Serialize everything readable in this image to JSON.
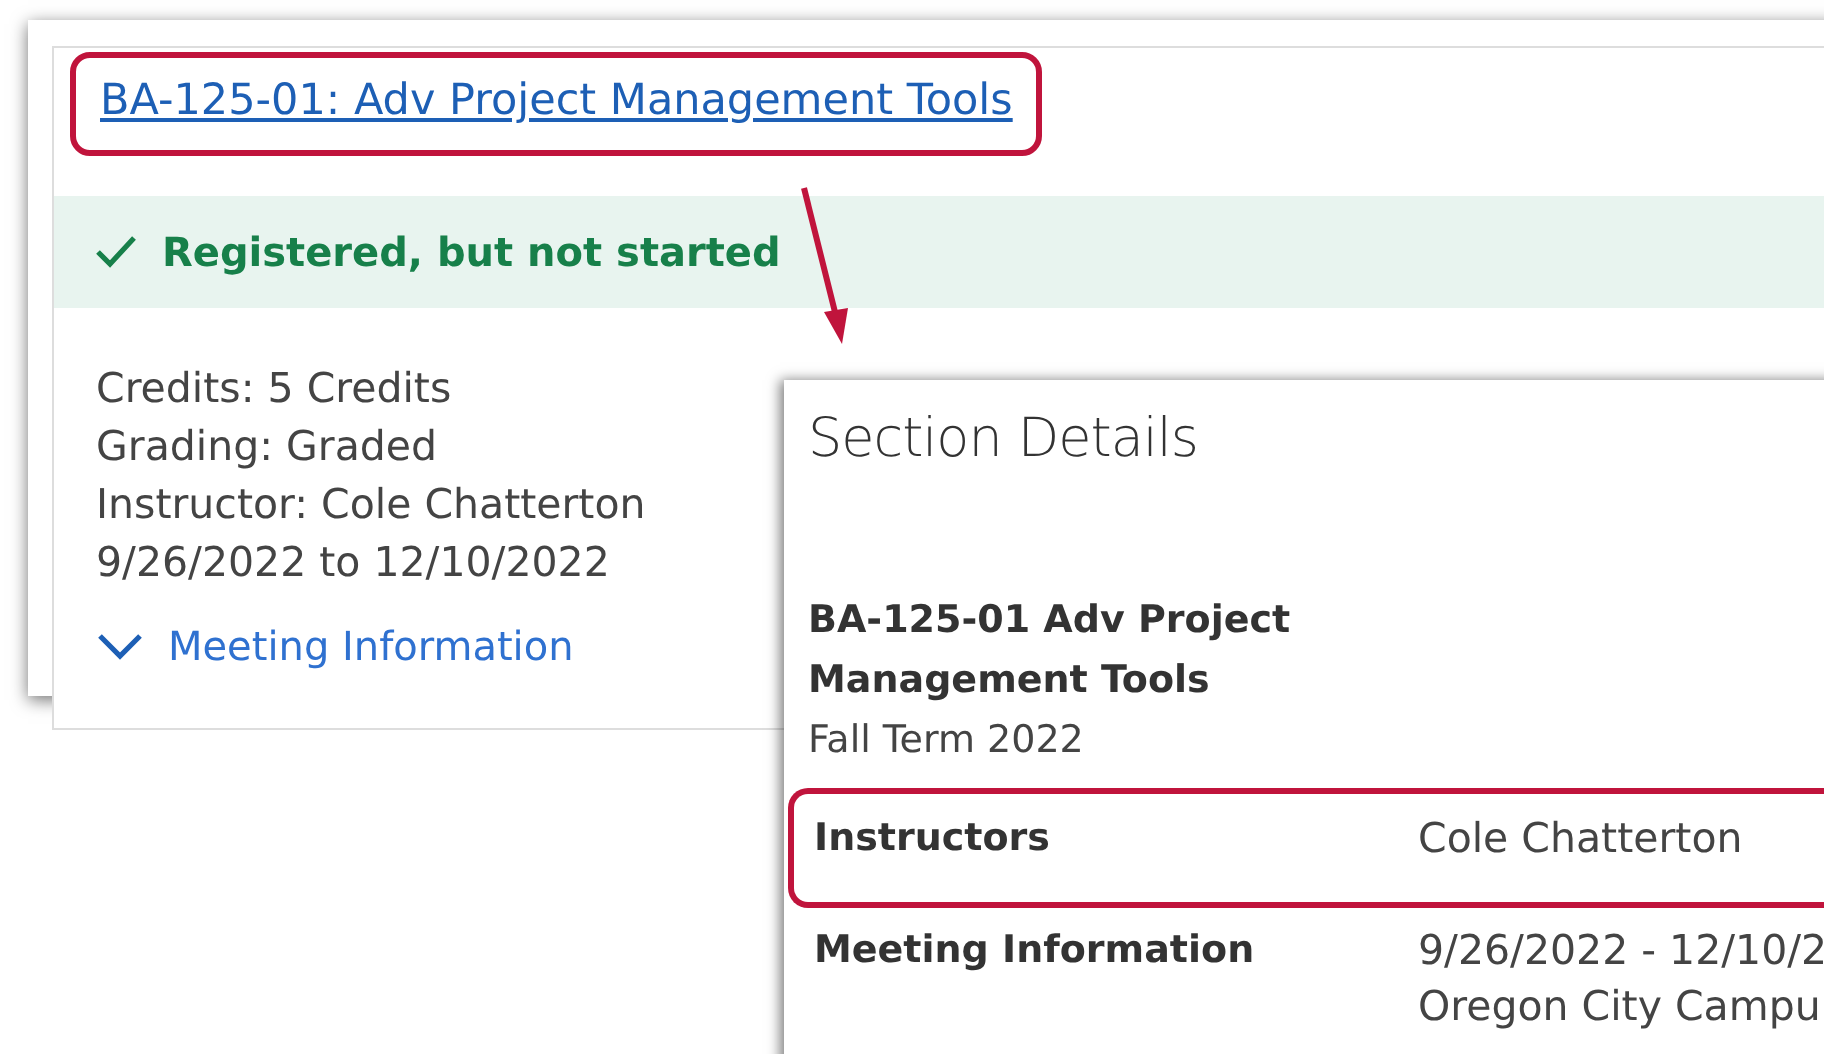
{
  "card": {
    "course_link": "BA-125-01: Adv Project Management Tools",
    "link_highlighted": true,
    "status": {
      "text": "Registered, but not started",
      "kind": "registered"
    },
    "details": [
      "Credits: 5 Credits",
      "Grading: Graded",
      "Instructor: Cole Chatterton",
      "9/26/2022 to 12/10/2022"
    ],
    "meeting_toggle": {
      "label": "Meeting Information",
      "expanded": false
    }
  },
  "dialog": {
    "title": "Section Details",
    "course_title": "BA-125-01 Adv Project Management Tools",
    "term": "Fall Term 2022",
    "rows": [
      {
        "label": "Instructors",
        "values": [
          "Cole Chatterton"
        ],
        "highlighted": true
      },
      {
        "label": "Meeting Information",
        "values": [
          "9/26/2022 - 12/10/2",
          "Oregon City Campu"
        ],
        "highlighted": false
      }
    ]
  }
}
